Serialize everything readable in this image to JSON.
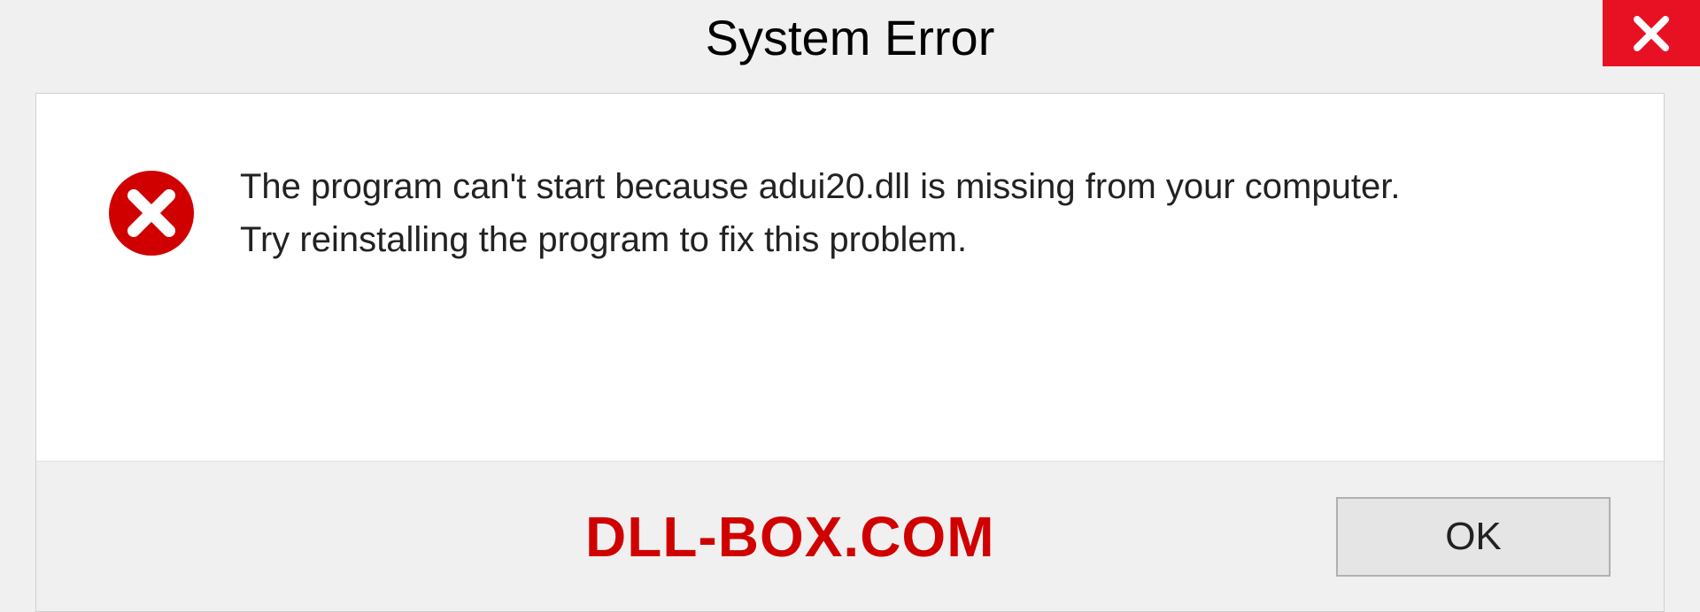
{
  "dialog": {
    "title": "System Error",
    "message_line1": "The program can't start because adui20.dll is missing from your computer.",
    "message_line2": "Try reinstalling the program to fix this problem.",
    "ok_label": "OK"
  },
  "watermark": "DLL-BOX.COM",
  "colors": {
    "close_red": "#e81123",
    "error_red": "#d00000",
    "watermark_red": "#d00000"
  }
}
